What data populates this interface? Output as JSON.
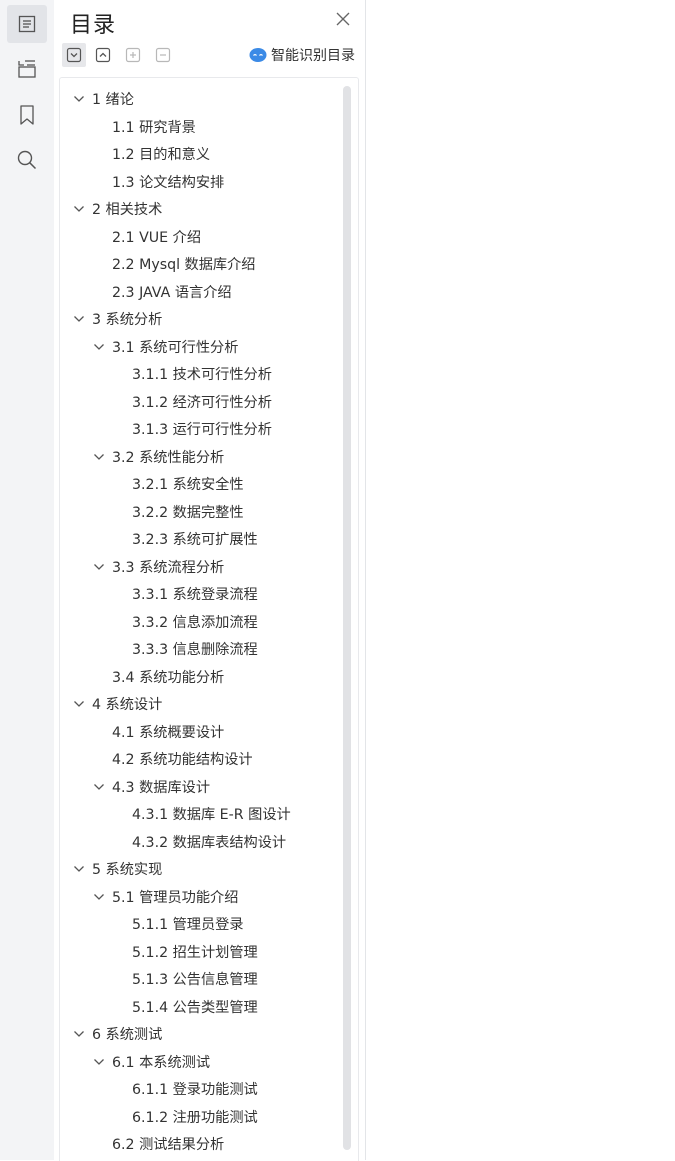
{
  "panel": {
    "title": "目录",
    "smart_label": "智能识别目录"
  },
  "rail": {
    "icons": [
      "toc-icon",
      "outline-tree-icon",
      "bookmark-icon",
      "search-icon"
    ]
  },
  "toolbar": {
    "buttons": [
      "expand-all",
      "collapse-all",
      "add-entry",
      "remove-entry"
    ]
  },
  "toc": [
    {
      "text": "1  绪论",
      "level": 0,
      "expandable": true
    },
    {
      "text": "1.1  研究背景",
      "level": 1,
      "expandable": false
    },
    {
      "text": "1.2 目的和意义",
      "level": 1,
      "expandable": false
    },
    {
      "text": "1.3  论文结构安排",
      "level": 1,
      "expandable": false
    },
    {
      "text": "2  相关技术",
      "level": 0,
      "expandable": true
    },
    {
      "text": "2.1 VUE 介绍",
      "level": 1,
      "expandable": false
    },
    {
      "text": "2.2 Mysql 数据库介绍",
      "level": 1,
      "expandable": false
    },
    {
      "text": "2.3 JAVA 语言介绍",
      "level": 1,
      "expandable": false
    },
    {
      "text": "3  系统分析",
      "level": 0,
      "expandable": true
    },
    {
      "text": "3.1 系统可行性分析",
      "level": 1,
      "expandable": true
    },
    {
      "text": "3.1.1  技术可行性分析",
      "level": 2,
      "expandable": false
    },
    {
      "text": "3.1.2  经济可行性分析",
      "level": 2,
      "expandable": false
    },
    {
      "text": "3.1.3  运行可行性分析",
      "level": 2,
      "expandable": false
    },
    {
      "text": "3.2 系统性能分析",
      "level": 1,
      "expandable": true
    },
    {
      "text": "3.2.1  系统安全性",
      "level": 2,
      "expandable": false
    },
    {
      "text": "3.2.2  数据完整性",
      "level": 2,
      "expandable": false
    },
    {
      "text": "3.2.3 系统可扩展性",
      "level": 2,
      "expandable": false
    },
    {
      "text": "3.3 系统流程分析",
      "level": 1,
      "expandable": true
    },
    {
      "text": "3.3.1 系统登录流程",
      "level": 2,
      "expandable": false
    },
    {
      "text": "3.3.2 信息添加流程",
      "level": 2,
      "expandable": false
    },
    {
      "text": "3.3.3 信息删除流程",
      "level": 2,
      "expandable": false
    },
    {
      "text": "3.4 系统功能分析",
      "level": 1,
      "expandable": false
    },
    {
      "text": "4  系统设计",
      "level": 0,
      "expandable": true
    },
    {
      "text": "4.1 系统概要设计",
      "level": 1,
      "expandable": false
    },
    {
      "text": "4.2 系统功能结构设计",
      "level": 1,
      "expandable": false
    },
    {
      "text": "4.3 数据库设计",
      "level": 1,
      "expandable": true
    },
    {
      "text": "4.3.1 数据库 E-R 图设计",
      "level": 2,
      "expandable": false
    },
    {
      "text": "4.3.2  数据库表结构设计",
      "level": 2,
      "expandable": false
    },
    {
      "text": "5  系统实现",
      "level": 0,
      "expandable": true
    },
    {
      "text": "5.1 管理员功能介绍",
      "level": 1,
      "expandable": true
    },
    {
      "text": "5.1.1 管理员登录",
      "level": 2,
      "expandable": false
    },
    {
      "text": "5.1.2  招生计划管理",
      "level": 2,
      "expandable": false
    },
    {
      "text": "5.1.3  公告信息管理",
      "level": 2,
      "expandable": false
    },
    {
      "text": "5.1.4 公告类型管理",
      "level": 2,
      "expandable": false
    },
    {
      "text": "6 系统测试",
      "level": 0,
      "expandable": true
    },
    {
      "text": "6.1  本系统测试",
      "level": 1,
      "expandable": true
    },
    {
      "text": "6.1.1  登录功能测试",
      "level": 2,
      "expandable": false
    },
    {
      "text": "6.1.2  注册功能测试",
      "level": 2,
      "expandable": false
    },
    {
      "text": "6.2 测试结果分析",
      "level": 1,
      "expandable": false
    }
  ],
  "colors": {
    "accent": "#3b8ae6",
    "text": "#333333",
    "icon": "#555555"
  }
}
